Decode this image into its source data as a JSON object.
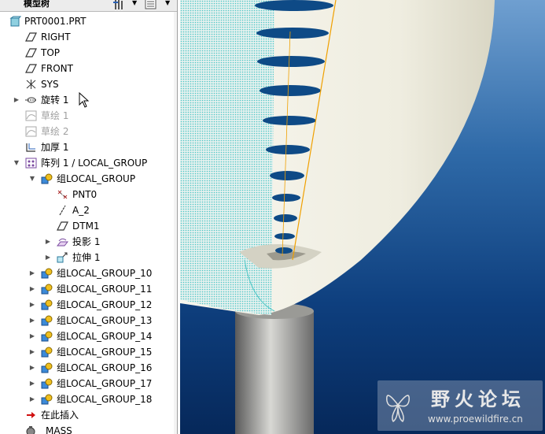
{
  "panel": {
    "title": "模型树"
  },
  "tree": {
    "root": "PRT0001.PRT",
    "items": [
      {
        "label": "RIGHT",
        "icon": "datum-plane-icon"
      },
      {
        "label": "TOP",
        "icon": "datum-plane-icon"
      },
      {
        "label": "FRONT",
        "icon": "datum-plane-icon"
      },
      {
        "label": "SYS",
        "icon": "coordinate-system-icon"
      },
      {
        "label": "旋转 1",
        "icon": "revolve-icon"
      },
      {
        "label": "草绘 1",
        "icon": "sketch-icon"
      },
      {
        "label": "草绘 2",
        "icon": "sketch-icon"
      },
      {
        "label": "加厚 1",
        "icon": "thicken-icon"
      },
      {
        "label": "阵列 1 / LOCAL_GROUP",
        "icon": "pattern-icon"
      },
      {
        "label": "组LOCAL_GROUP",
        "icon": "group-icon"
      },
      {
        "label": "PNT0",
        "icon": "datum-point-icon"
      },
      {
        "label": "A_2",
        "icon": "datum-axis-icon"
      },
      {
        "label": "DTM1",
        "icon": "datum-plane-icon"
      },
      {
        "label": "投影 1",
        "icon": "projection-icon"
      },
      {
        "label": "拉伸 1",
        "icon": "extrude-icon"
      },
      {
        "label": "组LOCAL_GROUP_10",
        "icon": "group-icon"
      },
      {
        "label": "组LOCAL_GROUP_11",
        "icon": "group-icon"
      },
      {
        "label": "组LOCAL_GROUP_12",
        "icon": "group-icon"
      },
      {
        "label": "组LOCAL_GROUP_13",
        "icon": "group-icon"
      },
      {
        "label": "组LOCAL_GROUP_14",
        "icon": "group-icon"
      },
      {
        "label": "组LOCAL_GROUP_15",
        "icon": "group-icon"
      },
      {
        "label": "组LOCAL_GROUP_16",
        "icon": "group-icon"
      },
      {
        "label": "组LOCAL_GROUP_17",
        "icon": "group-icon"
      },
      {
        "label": "组LOCAL_GROUP_18",
        "icon": "group-icon"
      },
      {
        "label": "在此插入",
        "icon": "insert-here-arrow-icon"
      },
      {
        "label": "MASS",
        "icon": "mass-icon"
      }
    ]
  },
  "watermark": {
    "title": "野火论坛",
    "url": "www.proewildfire.cn"
  },
  "colors": {
    "viewport_top": "#6f9fd0",
    "viewport_bottom": "#06285a",
    "surface": "#f2f1e6",
    "highlight": "#4ec6c6",
    "datum_axis": "#f0a000",
    "slot": "#0e4a86"
  }
}
